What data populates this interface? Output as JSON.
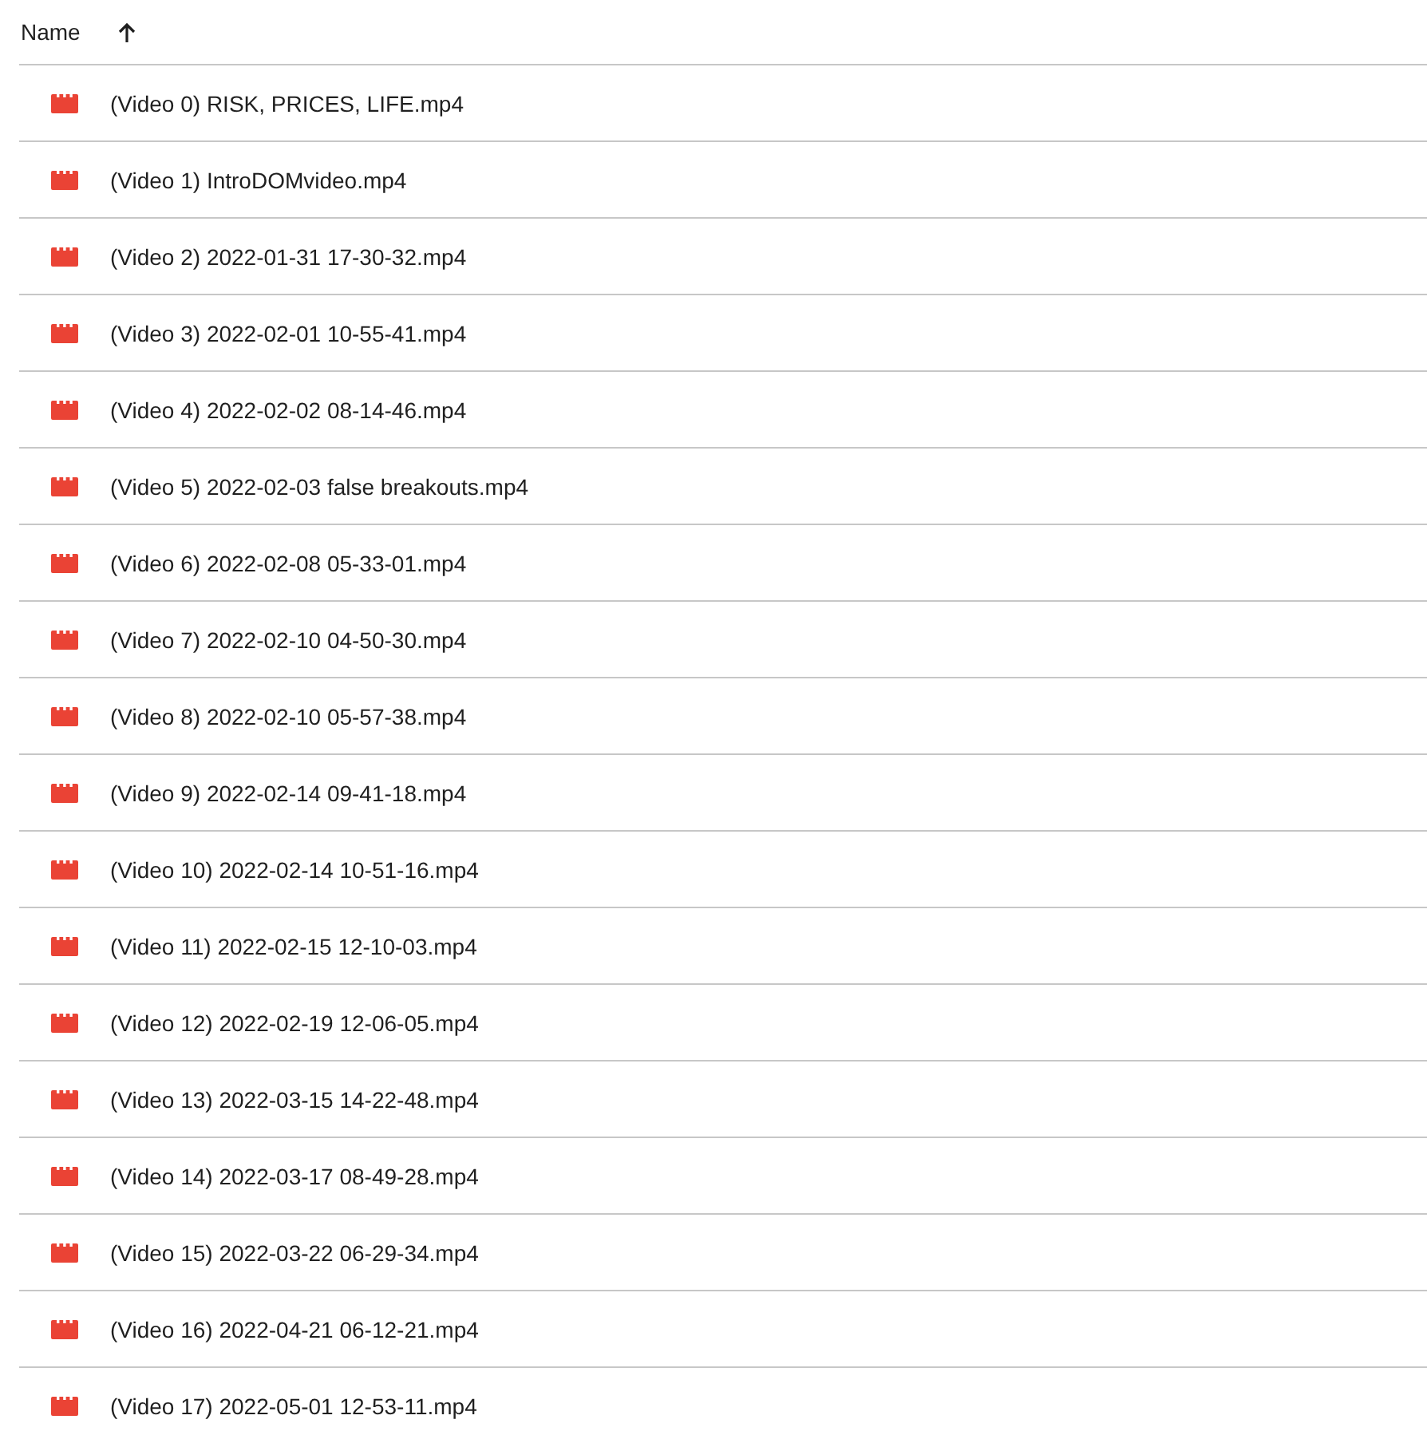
{
  "header": {
    "label": "Name",
    "sort_ascending": true
  },
  "files": [
    {
      "name": "(Video 0) RISK, PRICES, LIFE.mp4"
    },
    {
      "name": "(Video 1) IntroDOMvideo.mp4"
    },
    {
      "name": "(Video 2) 2022-01-31 17-30-32.mp4"
    },
    {
      "name": "(Video 3) 2022-02-01 10-55-41.mp4"
    },
    {
      "name": "(Video 4) 2022-02-02 08-14-46.mp4"
    },
    {
      "name": "(Video 5) 2022-02-03 false breakouts.mp4"
    },
    {
      "name": "(Video 6) 2022-02-08 05-33-01.mp4"
    },
    {
      "name": "(Video 7) 2022-02-10 04-50-30.mp4"
    },
    {
      "name": "(Video 8) 2022-02-10 05-57-38.mp4"
    },
    {
      "name": "(Video 9) 2022-02-14 09-41-18.mp4"
    },
    {
      "name": "(Video 10) 2022-02-14 10-51-16.mp4"
    },
    {
      "name": "(Video 11) 2022-02-15 12-10-03.mp4"
    },
    {
      "name": "(Video 12) 2022-02-19 12-06-05.mp4"
    },
    {
      "name": "(Video 13) 2022-03-15 14-22-48.mp4"
    },
    {
      "name": "(Video 14) 2022-03-17 08-49-28.mp4"
    },
    {
      "name": "(Video 15) 2022-03-22 06-29-34.mp4"
    },
    {
      "name": "(Video 16) 2022-04-21 06-12-21.mp4"
    },
    {
      "name": "(Video 17) 2022-05-01 12-53-11.mp4"
    }
  ]
}
